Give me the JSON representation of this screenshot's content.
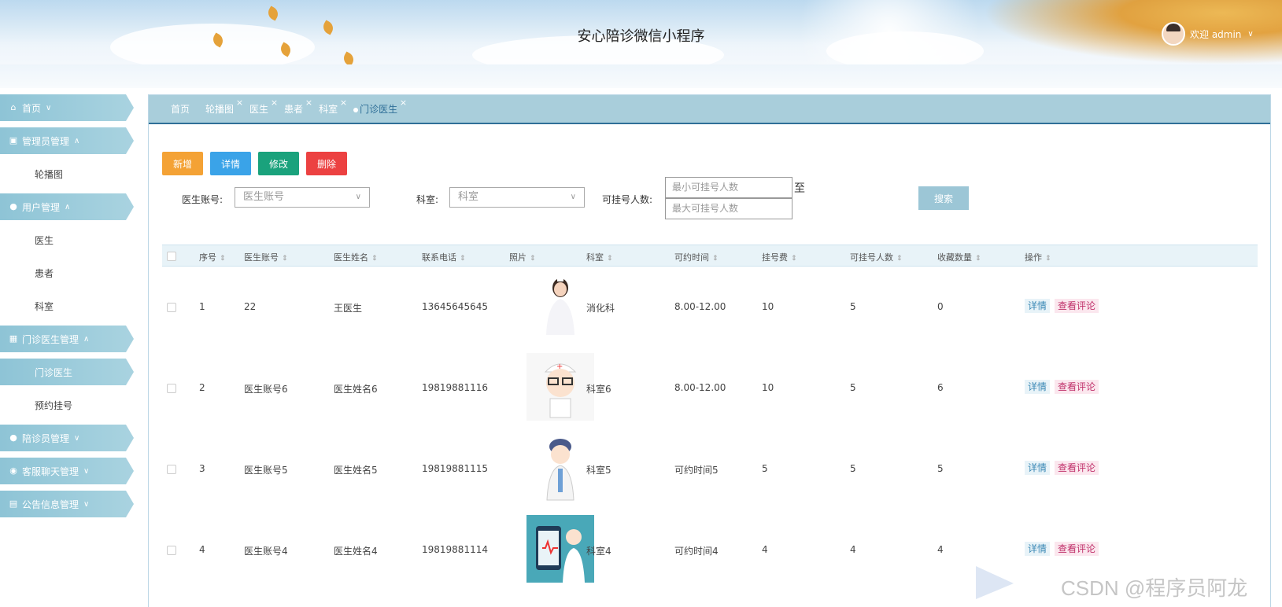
{
  "header": {
    "title": "安心陪诊微信小程序",
    "welcome": "欢迎 admin"
  },
  "sidebar": {
    "items": [
      {
        "label": "首页",
        "icon": "home-icon",
        "type": "menu",
        "chev": "∨"
      },
      {
        "label": "管理员管理",
        "icon": "gift-icon",
        "type": "menu",
        "chev": "∧"
      },
      {
        "label": "轮播图",
        "type": "sub"
      },
      {
        "label": "用户管理",
        "icon": "user-icon",
        "type": "menu",
        "chev": "∧"
      },
      {
        "label": "医生",
        "type": "sub"
      },
      {
        "label": "患者",
        "type": "sub"
      },
      {
        "label": "科室",
        "type": "sub"
      },
      {
        "label": "门诊医生管理",
        "icon": "building-icon",
        "type": "menu",
        "chev": "∧"
      },
      {
        "label": "门诊医生",
        "type": "sub",
        "active": true
      },
      {
        "label": "预约挂号",
        "type": "sub"
      },
      {
        "label": "陪诊员管理",
        "icon": "user-icon",
        "type": "menu",
        "chev": "∨"
      },
      {
        "label": "客服聊天管理",
        "icon": "chat-icon",
        "type": "menu",
        "chev": "∨"
      },
      {
        "label": "公告信息管理",
        "icon": "notice-icon",
        "type": "menu",
        "chev": "∨"
      }
    ]
  },
  "tabs": [
    "首页",
    "轮播图",
    "医生",
    "患者",
    "科室",
    "门诊医生"
  ],
  "toolbar": {
    "add": "新增",
    "detail": "详情",
    "edit": "修改",
    "delete": "删除"
  },
  "search": {
    "account_label": "医生账号:",
    "account_placeholder": "医生账号",
    "dept_label": "科室:",
    "dept_placeholder": "科室",
    "count_label": "可挂号人数:",
    "min_placeholder": "最小可挂号人数",
    "max_placeholder": "最大可挂号人数",
    "to": "至",
    "button": "搜索"
  },
  "table": {
    "columns": [
      "序号",
      "医生账号",
      "医生姓名",
      "联系电话",
      "照片",
      "科室",
      "可约时间",
      "挂号费",
      "可挂号人数",
      "收藏数量",
      "操作"
    ],
    "rows": [
      {
        "no": "1",
        "account": "22",
        "name": "王医生",
        "phone": "13645645645",
        "dept": "消化科",
        "time": "8.00-12.00",
        "fee": "10",
        "count": "5",
        "fav": "0"
      },
      {
        "no": "2",
        "account": "医生账号6",
        "name": "医生姓名6",
        "phone": "19819881116",
        "dept": "科室6",
        "time": "8.00-12.00",
        "fee": "10",
        "count": "5",
        "fav": "6"
      },
      {
        "no": "3",
        "account": "医生账号5",
        "name": "医生姓名5",
        "phone": "19819881115",
        "dept": "科室5",
        "time": "可约时间5",
        "fee": "5",
        "count": "5",
        "fav": "5"
      },
      {
        "no": "4",
        "account": "医生账号4",
        "name": "医生姓名4",
        "phone": "19819881114",
        "dept": "科室4",
        "time": "可约时间4",
        "fee": "4",
        "count": "4",
        "fav": "4"
      }
    ],
    "op_detail": "详情",
    "op_comment": "查看评论"
  },
  "watermark": "CSDN @程序员阿龙",
  "colors": {
    "add": "#f4a235",
    "detail": "#3aa3e8",
    "edit": "#1aa27c",
    "delete": "#ec4141",
    "menu": "#9ccbd9",
    "tab_border": "#2f6f98"
  }
}
